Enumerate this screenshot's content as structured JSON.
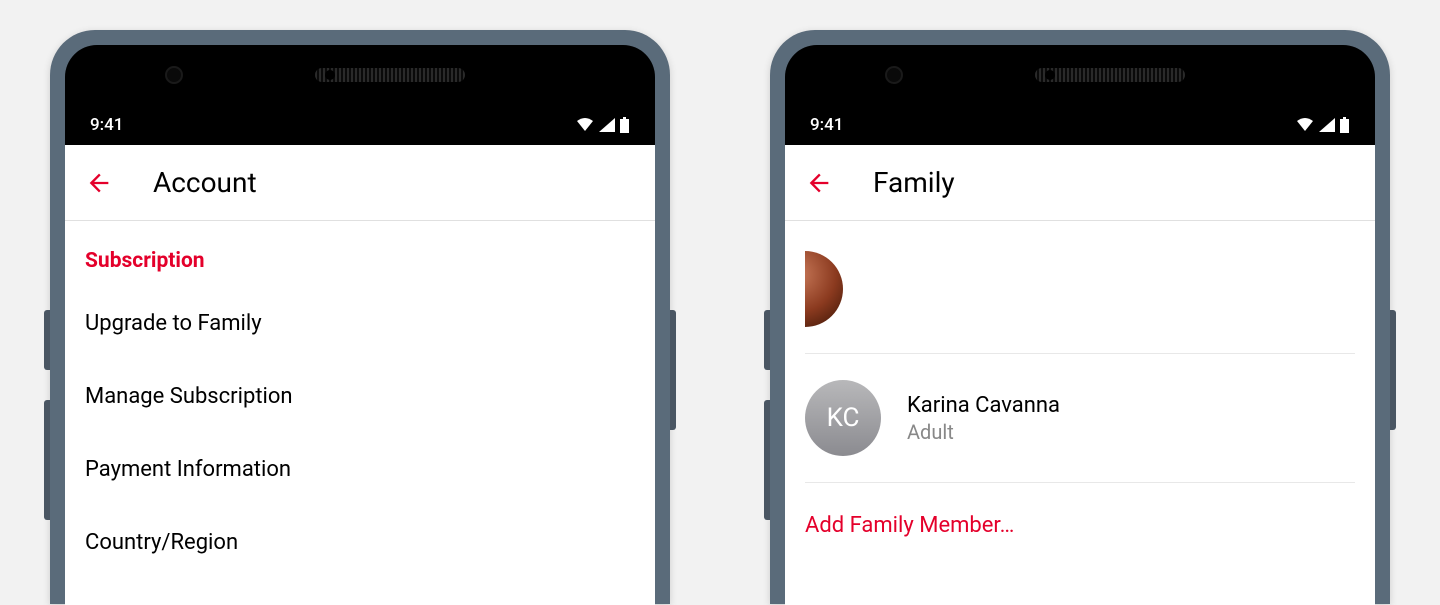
{
  "status": {
    "time": "9:41"
  },
  "left_screen": {
    "title": "Account",
    "section_header": "Subscription",
    "items": [
      "Upgrade to Family",
      "Manage Subscription",
      "Payment Information",
      "Country/Region"
    ]
  },
  "right_screen": {
    "title": "Family",
    "members": [
      {
        "initials": "KC",
        "name": "Karina Cavanna",
        "role": "Adult"
      }
    ],
    "add_label": "Add Family Member…"
  }
}
